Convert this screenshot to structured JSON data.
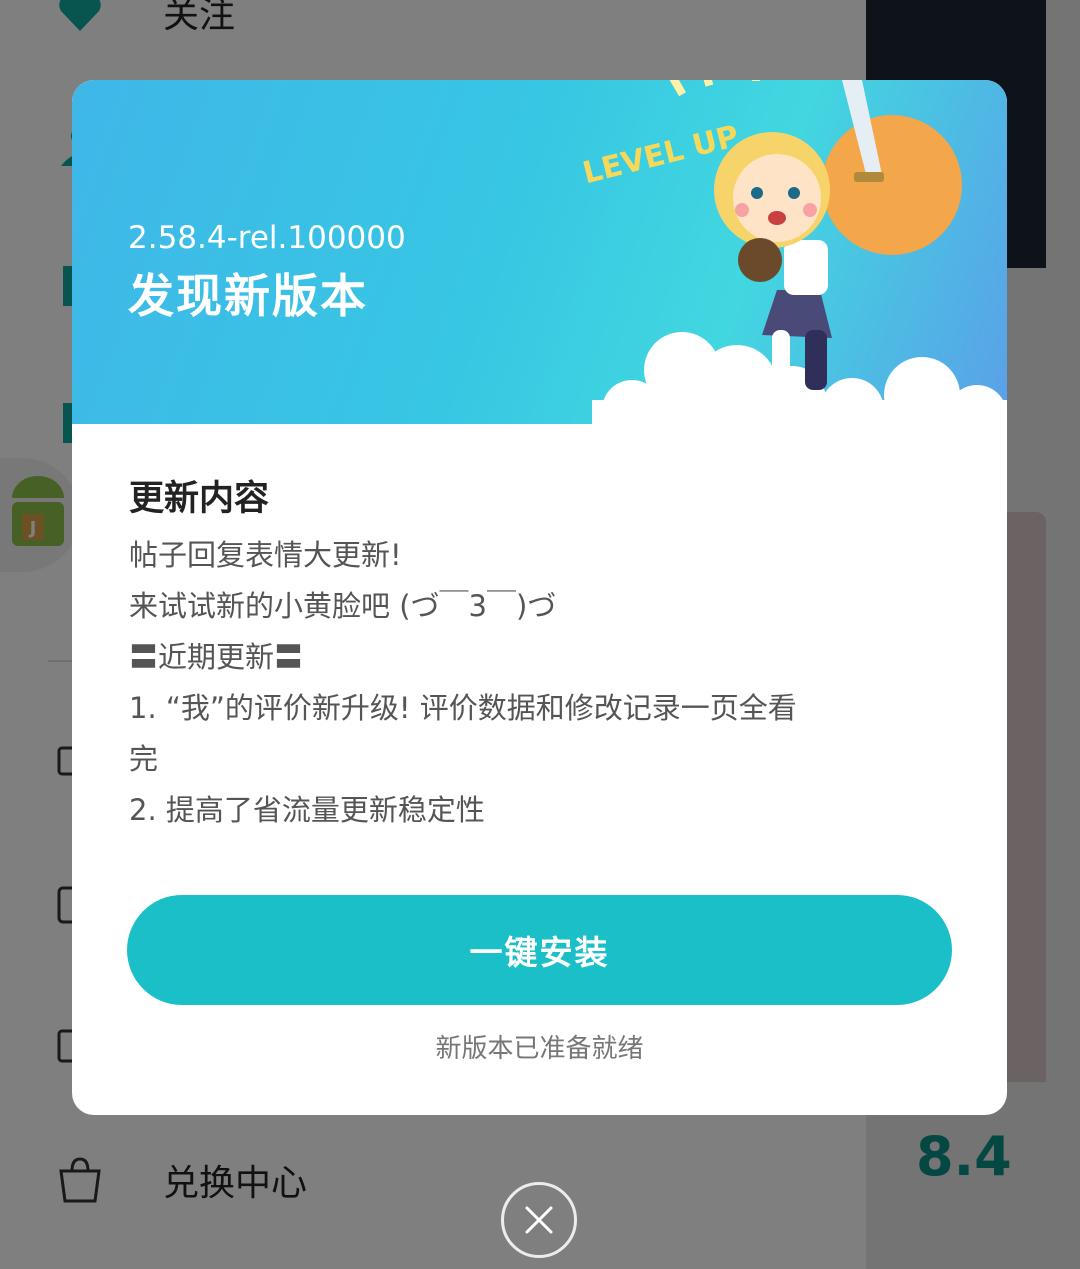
{
  "background": {
    "menu": [
      {
        "label": "关注",
        "icon": "heart-icon"
      },
      {
        "label": "",
        "icon": "user-icon"
      },
      {
        "label": "",
        "icon": "bookmark-icon"
      },
      {
        "label": "",
        "icon": "list-icon"
      },
      {
        "label": "",
        "icon": "monitor-icon"
      },
      {
        "label": "",
        "icon": "card-icon"
      },
      {
        "label": "",
        "icon": "gift-icon"
      },
      {
        "label": "兑换中心",
        "icon": "shopping-bag-icon"
      }
    ],
    "rating": "8.4"
  },
  "dialog": {
    "version": "2.58.4-rel.100000",
    "title": "发现新版本",
    "banner_art_text": "LEVEL UP",
    "section_title": "更新内容",
    "notes": [
      "帖子回复表情大更新!",
      "来试试新的小黄脸吧 (づ￣3￣)づ",
      "〓近期更新〓",
      "1. “我”的评价新升级! 评价数据和修改记录一页全看",
      "完",
      "2. 提高了省流量更新稳定性"
    ],
    "install_label": "一键安装",
    "ready_label": "新版本已准备就绪"
  },
  "colors": {
    "accent": "#1bbfc7",
    "banner_start": "#3fb7e8",
    "banner_end": "#5aa0e8"
  }
}
